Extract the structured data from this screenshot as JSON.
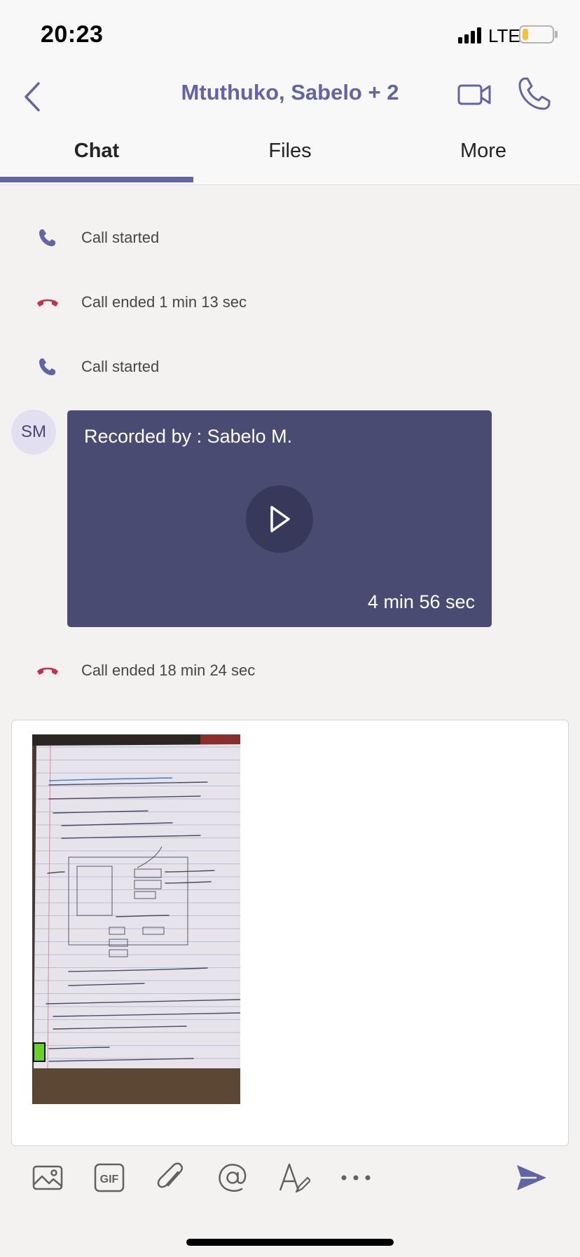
{
  "status_bar": {
    "time": "20:23",
    "network": "LTE",
    "battery_level": 0.2,
    "icons": [
      "signal-bars-icon",
      "battery-icon"
    ]
  },
  "header": {
    "title": "Mtuthuko, Sabelo + 2",
    "icons": [
      "back-chevron-icon",
      "video-camera-icon",
      "phone-icon"
    ]
  },
  "tabs": [
    {
      "label": "Chat",
      "active": true
    },
    {
      "label": "Files",
      "active": false
    },
    {
      "label": "More",
      "active": false
    }
  ],
  "messages": [
    {
      "type": "call-start",
      "text": "Call started",
      "icon": "phone-icon"
    },
    {
      "type": "call-end",
      "text": "Call ended 1 min 13 sec",
      "icon": "hang-up-icon"
    },
    {
      "type": "call-start",
      "text": "Call started",
      "icon": "phone-icon"
    },
    {
      "type": "call-end",
      "text": "Call ended 18 min 24 sec",
      "icon": "hang-up-icon"
    }
  ],
  "recording": {
    "avatar_initials": "SM",
    "title": "Recorded by : Sabelo M.",
    "duration": "4 min 56 sec"
  },
  "compose": {
    "attachment": {
      "heading": "Requirements for 1st official sprint:",
      "lines": [
        "Database set up that stores the info captured",
        "Front End clone",
        "Login system",
        "New Exam -> enter info that matters",
        "Special Requests",
        "In DB, make table of venues: \"name\", \"size\", \"special requirements\"",
        "Create table of \"course code\" \"course name\" \"#of students\"",
        "PHP preferred",
        "Sexy front end: Bootstrap, Django, React"
      ]
    }
  },
  "toolbar": {
    "icons": [
      "image-icon",
      "gif-icon",
      "attach-icon",
      "mention-icon",
      "format-icon",
      "more-icon",
      "send-icon"
    ],
    "gif_label": "GIF"
  },
  "colors": {
    "accent": "#6264a7",
    "hangup": "#c4314b",
    "recording_bg": "#4a4b72",
    "background": "#f3f2f1"
  }
}
